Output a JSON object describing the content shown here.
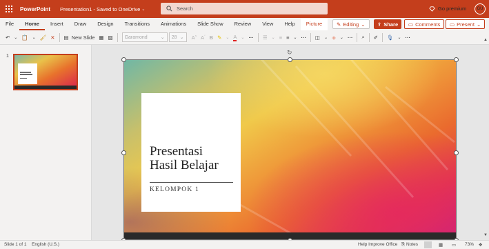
{
  "app": {
    "name": "PowerPoint",
    "doc_title": "Presentation1 - Saved to OneDrive",
    "go_premium": "Go premium",
    "avatar_initials": "GU",
    "brand_color": "#c43e1c"
  },
  "search": {
    "placeholder": "Search"
  },
  "tabs": [
    {
      "label": "File"
    },
    {
      "label": "Home"
    },
    {
      "label": "Insert"
    },
    {
      "label": "Draw"
    },
    {
      "label": "Design"
    },
    {
      "label": "Transitions"
    },
    {
      "label": "Animations"
    },
    {
      "label": "Slide Show"
    },
    {
      "label": "Review"
    },
    {
      "label": "View"
    },
    {
      "label": "Help"
    },
    {
      "label": "Picture"
    }
  ],
  "actions": {
    "editing": "Editing",
    "share": "Share",
    "comments": "Comments",
    "present": "Present"
  },
  "ribbon": {
    "new_slide": "New Slide",
    "font_name": "Garamond",
    "font_size": "28"
  },
  "thumbnails": {
    "slide_number": "1"
  },
  "slide": {
    "title_line1": "Presentasi",
    "title_line2": "Hasil Belajar",
    "subtitle": "KELOMPOK 1"
  },
  "status": {
    "slide_of": "Slide 1 of 1",
    "language": "English (U.S.)",
    "help_improve": "Help Improve Office",
    "notes": "Notes",
    "zoom": "73%"
  }
}
